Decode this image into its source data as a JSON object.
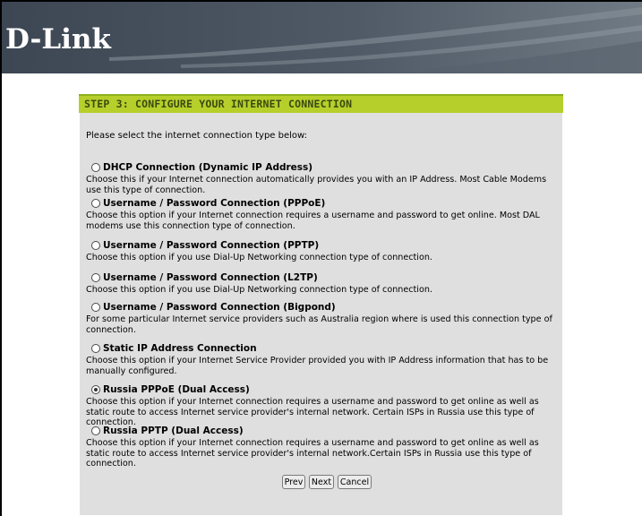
{
  "brand": {
    "logo_text": "D-Link"
  },
  "step": {
    "title": "STEP 3: CONFIGURE YOUR INTERNET CONNECTION"
  },
  "intro": "Please select the internet connection type below:",
  "options": [
    {
      "title": "DHCP Connection (Dynamic IP Address)",
      "description": "Choose this if your Internet connection automatically provides you with an IP Address. Most Cable Modems use this type of connection.",
      "selected": false
    },
    {
      "title": "Username / Password Connection (PPPoE)",
      "description": "Choose this option if your Internet connection requires a username and password to get online. Most DAL modems use this connection type of connection.",
      "selected": false
    },
    {
      "title": "Username / Password Connection (PPTP)",
      "description": "Choose this option if you use Dial-Up Networking connection type of connection.",
      "selected": false
    },
    {
      "title": "Username / Password Connection (L2TP)",
      "description": "Choose this option if you use Dial-Up Networking connection type of connection.",
      "selected": false
    },
    {
      "title": "Username / Password Connection (Bigpond)",
      "description": "For some particular Internet service providers such as Australia region where is used this connection type of connection.",
      "selected": false
    },
    {
      "title": "Static IP Address Connection",
      "description": "Choose this option if your Internet Service Provider provided you with IP Address information that has to be manually configured.",
      "selected": false
    },
    {
      "title": "Russia PPPoE (Dual Access)",
      "description": "Choose this option if your Internet connection requires a username and password to get online as well as static route to access Internet service provider's internal network. Certain ISPs in Russia use this type of connection.",
      "selected": true
    },
    {
      "title": "Russia PPTP (Dual Access)",
      "description": "Choose this option if your Internet connection requires a username and password to get online as well as static route to access Internet service provider's internal network.Certain ISPs in Russia use this type of connection.",
      "selected": false
    }
  ],
  "buttons": {
    "prev": "Prev",
    "next": "Next",
    "cancel": "Cancel"
  },
  "colors": {
    "header_bg": "#3d4653",
    "step_bar": "#b6cf2a",
    "panel_bg": "#dfdfdf"
  }
}
